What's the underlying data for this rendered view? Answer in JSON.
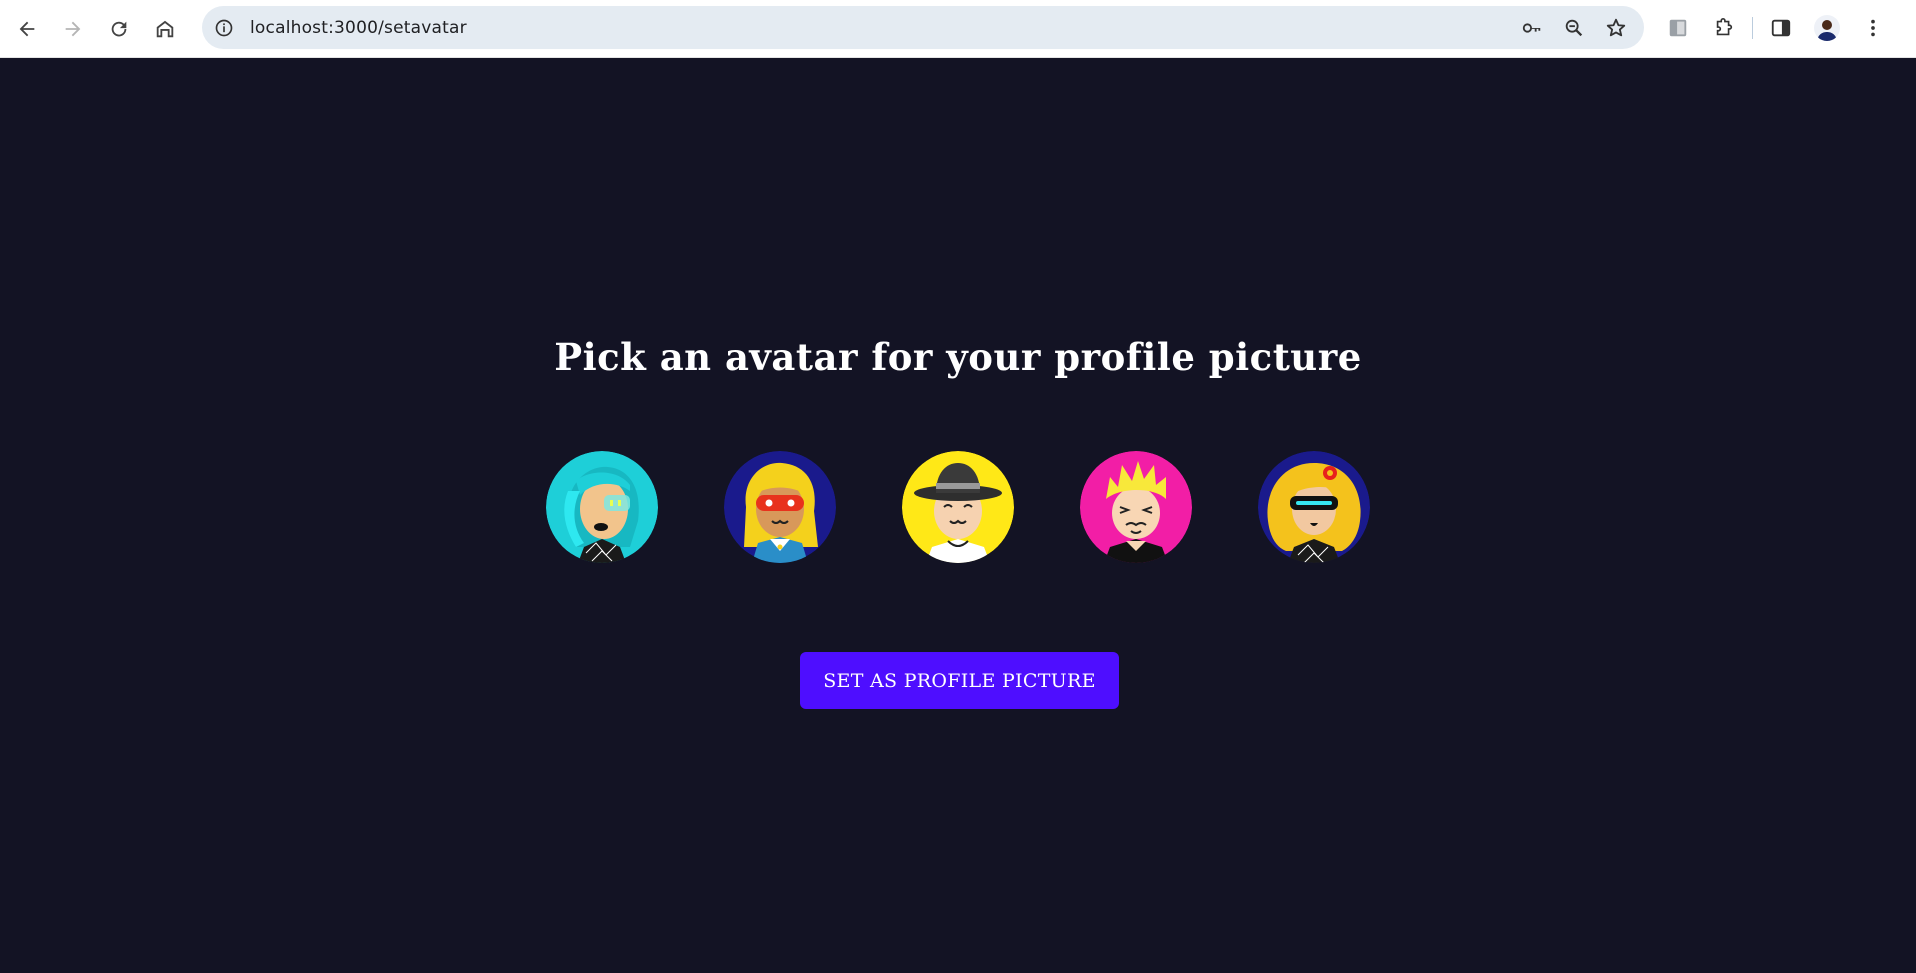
{
  "browser": {
    "url": "localhost:3000/setavatar",
    "icons": [
      "back-icon",
      "forward-icon",
      "reload-icon",
      "home-icon",
      "site-info-icon",
      "key-icon",
      "zoom-icon",
      "bookmark-star-icon",
      "extension-puzzle-icon",
      "side-panel-icon",
      "profile-avatar",
      "more-menu-icon"
    ]
  },
  "page": {
    "title": "Pick an avatar for your profile picture",
    "avatars": [
      {
        "description": "teal-haired woman avatar",
        "bg": "#1ecfd8"
      },
      {
        "description": "blonde masked avatar",
        "bg": "#1a1a8c"
      },
      {
        "description": "man with hat avatar",
        "bg": "#ffe817"
      },
      {
        "description": "spiky blonde avatar",
        "bg": "#f21ea6"
      },
      {
        "description": "blonde woman with flower avatar",
        "bg": "#1a1a8c"
      }
    ],
    "button_label": "SET AS PROFILE PICTURE"
  },
  "colors": {
    "background": "#131324",
    "accent": "#4e0eff",
    "text": "#ffffff"
  }
}
